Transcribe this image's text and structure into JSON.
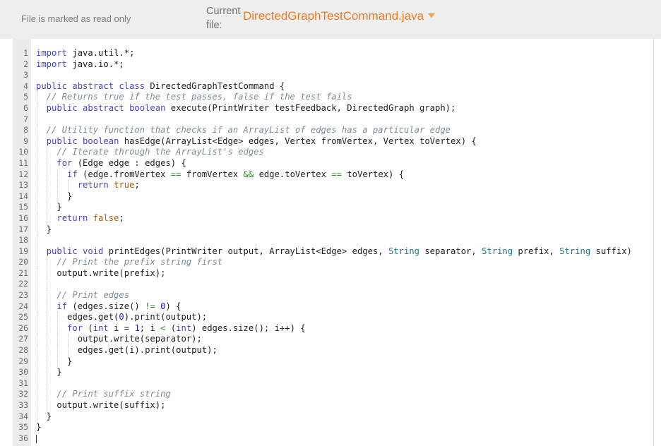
{
  "header": {
    "readonly_notice": "File is marked as read only",
    "current_file_label": "Current file:",
    "current_file_name": "DirectedGraphTestCommand.java",
    "caret_icon": "chevron-down-icon",
    "accent_color": "#f47b20",
    "background_color": "#eeeeee"
  },
  "editor": {
    "language": "java",
    "active_line": 36,
    "total_lines": 36,
    "gutter_color": "#ececec",
    "colors": {
      "keyword": "#4646c8",
      "comment": "#7e8c99",
      "type": "#1a7b8c",
      "literal": "#b35a00",
      "number": "#1b24c8",
      "operator": "#2e8b2e",
      "plain": "#202020"
    },
    "lines": [
      {
        "n": 1,
        "indent": 0,
        "tokens": [
          [
            "kw",
            "import"
          ],
          [
            "pl",
            " java.util.*;"
          ]
        ]
      },
      {
        "n": 2,
        "indent": 0,
        "tokens": [
          [
            "kw",
            "import"
          ],
          [
            "pl",
            " java.io.*;"
          ]
        ]
      },
      {
        "n": 3,
        "indent": 0,
        "tokens": []
      },
      {
        "n": 4,
        "indent": 0,
        "tokens": [
          [
            "kw",
            "public abstract class"
          ],
          [
            "pl",
            " DirectedGraphTestCommand {"
          ]
        ]
      },
      {
        "n": 5,
        "indent": 1,
        "tokens": [
          [
            "cm",
            "  // Returns true if the test passes, false if the test fails"
          ]
        ]
      },
      {
        "n": 6,
        "indent": 1,
        "tokens": [
          [
            "pl",
            "  "
          ],
          [
            "kw",
            "public abstract boolean"
          ],
          [
            "pl",
            " execute(PrintWriter testFeedback, DirectedGraph graph);"
          ]
        ]
      },
      {
        "n": 7,
        "indent": 1,
        "tokens": []
      },
      {
        "n": 8,
        "indent": 1,
        "tokens": [
          [
            "cm",
            "  // Utility function that checks if an ArrayList of edges has a particular edge"
          ]
        ]
      },
      {
        "n": 9,
        "indent": 1,
        "tokens": [
          [
            "pl",
            "  "
          ],
          [
            "kw",
            "public boolean"
          ],
          [
            "pl",
            " hasEdge(ArrayList<Edge> edges, Vertex fromVertex, Vertex toVertex) {"
          ]
        ]
      },
      {
        "n": 10,
        "indent": 2,
        "tokens": [
          [
            "cm",
            "    // Iterate through the ArrayList's edges"
          ]
        ]
      },
      {
        "n": 11,
        "indent": 2,
        "tokens": [
          [
            "pl",
            "    "
          ],
          [
            "kw",
            "for"
          ],
          [
            "pl",
            " (Edge edge : edges) {"
          ]
        ]
      },
      {
        "n": 12,
        "indent": 3,
        "tokens": [
          [
            "pl",
            "      "
          ],
          [
            "kw",
            "if"
          ],
          [
            "pl",
            " (edge.fromVertex "
          ],
          [
            "op",
            "=="
          ],
          [
            "pl",
            " fromVertex "
          ],
          [
            "op",
            "&&"
          ],
          [
            "pl",
            " edge.toVertex "
          ],
          [
            "op",
            "=="
          ],
          [
            "pl",
            " toVertex) {"
          ]
        ]
      },
      {
        "n": 13,
        "indent": 4,
        "tokens": [
          [
            "pl",
            "        "
          ],
          [
            "kw",
            "return"
          ],
          [
            "pl",
            " "
          ],
          [
            "lit",
            "true"
          ],
          [
            "pl",
            ";"
          ]
        ]
      },
      {
        "n": 14,
        "indent": 3,
        "tokens": [
          [
            "pl",
            "      }"
          ]
        ]
      },
      {
        "n": 15,
        "indent": 2,
        "tokens": [
          [
            "pl",
            "    }"
          ]
        ]
      },
      {
        "n": 16,
        "indent": 2,
        "tokens": [
          [
            "pl",
            "    "
          ],
          [
            "kw",
            "return"
          ],
          [
            "pl",
            " "
          ],
          [
            "lit",
            "false"
          ],
          [
            "pl",
            ";"
          ]
        ]
      },
      {
        "n": 17,
        "indent": 1,
        "tokens": [
          [
            "pl",
            "  }"
          ]
        ]
      },
      {
        "n": 18,
        "indent": 1,
        "tokens": []
      },
      {
        "n": 19,
        "indent": 1,
        "tokens": [
          [
            "pl",
            "  "
          ],
          [
            "kw",
            "public void"
          ],
          [
            "pl",
            " printEdges(PrintWriter output, ArrayList<Edge> edges, "
          ],
          [
            "ty",
            "String"
          ],
          [
            "pl",
            " separator, "
          ],
          [
            "ty",
            "String"
          ],
          [
            "pl",
            " prefix, "
          ],
          [
            "ty",
            "String"
          ],
          [
            "pl",
            " suffix)"
          ]
        ]
      },
      {
        "n": 20,
        "indent": 2,
        "tokens": [
          [
            "cm",
            "    // Print the prefix string first"
          ]
        ]
      },
      {
        "n": 21,
        "indent": 2,
        "tokens": [
          [
            "pl",
            "    output.write(prefix);"
          ]
        ]
      },
      {
        "n": 22,
        "indent": 2,
        "tokens": []
      },
      {
        "n": 23,
        "indent": 2,
        "tokens": [
          [
            "cm",
            "    // Print edges"
          ]
        ]
      },
      {
        "n": 24,
        "indent": 2,
        "tokens": [
          [
            "pl",
            "    "
          ],
          [
            "kw",
            "if"
          ],
          [
            "pl",
            " (edges.size() "
          ],
          [
            "op",
            "!="
          ],
          [
            "pl",
            " "
          ],
          [
            "num",
            "0"
          ],
          [
            "pl",
            ") {"
          ]
        ]
      },
      {
        "n": 25,
        "indent": 3,
        "tokens": [
          [
            "pl",
            "      edges.get("
          ],
          [
            "num",
            "0"
          ],
          [
            "pl",
            ").print(output);"
          ]
        ]
      },
      {
        "n": 26,
        "indent": 3,
        "tokens": [
          [
            "pl",
            "      "
          ],
          [
            "kw",
            "for"
          ],
          [
            "pl",
            " ("
          ],
          [
            "kw",
            "int"
          ],
          [
            "pl",
            " i = "
          ],
          [
            "num",
            "1"
          ],
          [
            "pl",
            "; i "
          ],
          [
            "op",
            "<"
          ],
          [
            "pl",
            " ("
          ],
          [
            "kw",
            "int"
          ],
          [
            "pl",
            ") edges.size(); i++) {"
          ]
        ]
      },
      {
        "n": 27,
        "indent": 4,
        "tokens": [
          [
            "pl",
            "        output.write(separator);"
          ]
        ]
      },
      {
        "n": 28,
        "indent": 4,
        "tokens": [
          [
            "pl",
            "        edges.get(i).print(output);"
          ]
        ]
      },
      {
        "n": 29,
        "indent": 3,
        "tokens": [
          [
            "pl",
            "      }"
          ]
        ]
      },
      {
        "n": 30,
        "indent": 2,
        "tokens": [
          [
            "pl",
            "    }"
          ]
        ]
      },
      {
        "n": 31,
        "indent": 2,
        "tokens": []
      },
      {
        "n": 32,
        "indent": 2,
        "tokens": [
          [
            "cm",
            "    // Print suffix string"
          ]
        ]
      },
      {
        "n": 33,
        "indent": 2,
        "tokens": [
          [
            "pl",
            "    output.write(suffix);"
          ]
        ]
      },
      {
        "n": 34,
        "indent": 1,
        "tokens": [
          [
            "pl",
            "  }"
          ]
        ]
      },
      {
        "n": 35,
        "indent": 0,
        "tokens": [
          [
            "pl",
            "}"
          ]
        ]
      },
      {
        "n": 36,
        "indent": 0,
        "tokens": []
      }
    ]
  }
}
